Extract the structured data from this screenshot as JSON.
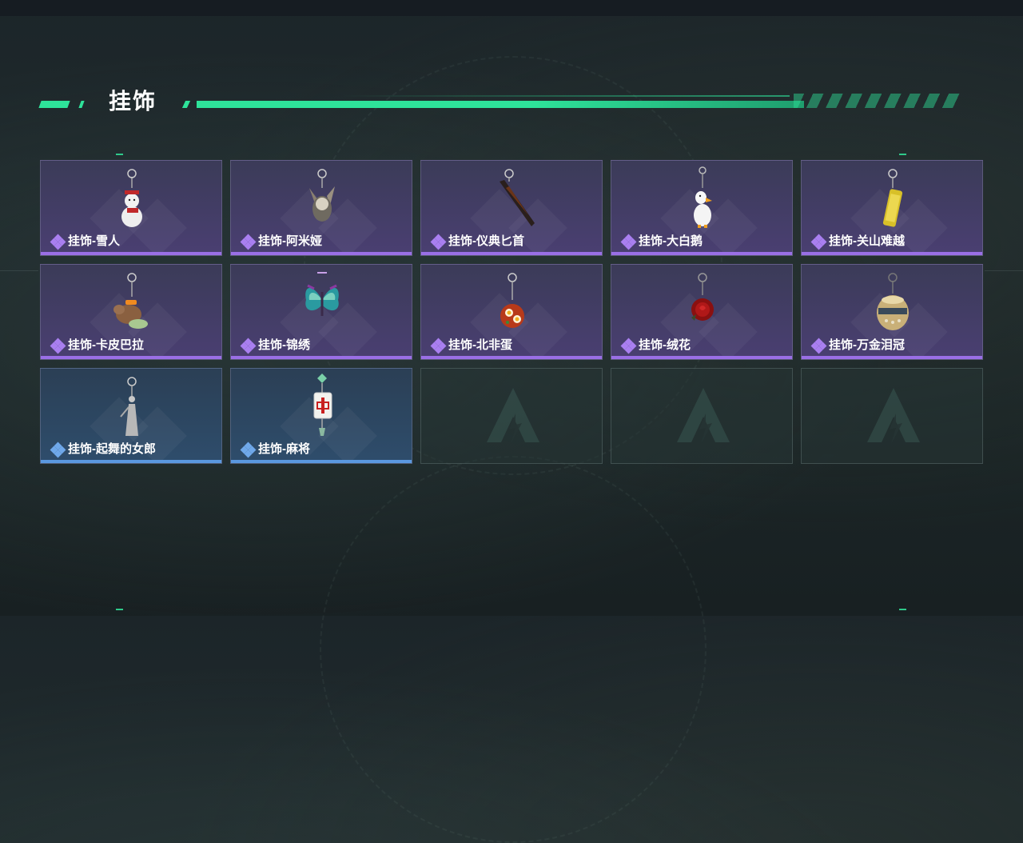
{
  "section": {
    "title": "挂饰"
  },
  "colors": {
    "accent": "#2ee39a",
    "epic": "#9a6fe6",
    "rare": "#5a98e0"
  },
  "items": [
    {
      "name": "挂饰-雪人",
      "rarity": "epic",
      "icon": "snowman-charm-icon"
    },
    {
      "name": "挂饰-阿米娅",
      "rarity": "epic",
      "icon": "amiya-charm-icon"
    },
    {
      "name": "挂饰-仪典匕首",
      "rarity": "epic",
      "icon": "dagger-charm-icon"
    },
    {
      "name": "挂饰-大白鹅",
      "rarity": "epic",
      "icon": "goose-charm-icon"
    },
    {
      "name": "挂饰-关山难越",
      "rarity": "epic",
      "icon": "scroll-charm-icon"
    },
    {
      "name": "挂饰-卡皮巴拉",
      "rarity": "epic",
      "icon": "capybara-charm-icon"
    },
    {
      "name": "挂饰-锦绣",
      "rarity": "epic",
      "icon": "butterfly-charm-icon"
    },
    {
      "name": "挂饰-北非蛋",
      "rarity": "epic",
      "icon": "shakshuka-charm-icon"
    },
    {
      "name": "挂饰-绒花",
      "rarity": "epic",
      "icon": "rose-charm-icon"
    },
    {
      "name": "挂饰-万金泪冠",
      "rarity": "epic",
      "icon": "crown-charm-icon"
    },
    {
      "name": "挂饰-起舞的女郎",
      "rarity": "rare",
      "icon": "dancer-charm-icon"
    },
    {
      "name": "挂饰-麻将",
      "rarity": "rare",
      "icon": "mahjong-charm-icon"
    }
  ],
  "empty_slots": 3
}
